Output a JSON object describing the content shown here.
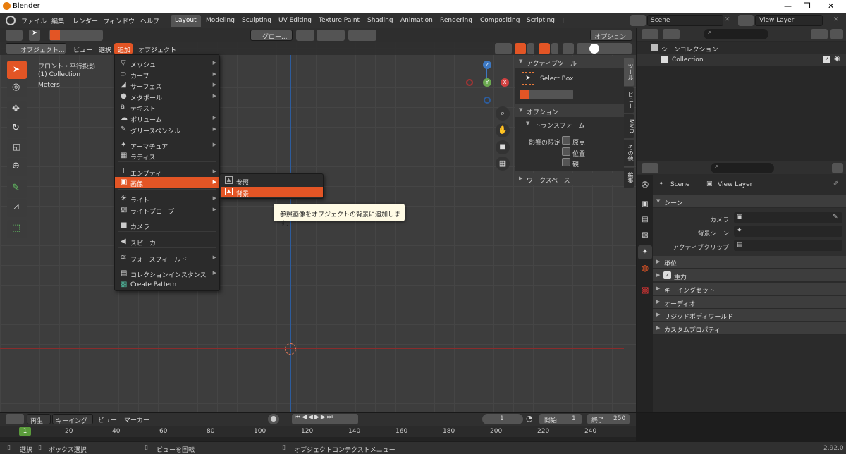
{
  "window": {
    "title": "Blender",
    "controls": [
      "—",
      "❐",
      "✕"
    ]
  },
  "menus": [
    "ファイル",
    "編集",
    "レンダー",
    "ウィンドウ",
    "ヘルプ"
  ],
  "workspaces": [
    "Layout",
    "Modeling",
    "Sculpting",
    "UV Editing",
    "Texture Paint",
    "Shading",
    "Animation",
    "Rendering",
    "Compositing",
    "Scripting"
  ],
  "add_tab": "+",
  "scene": {
    "name": "Scene",
    "view_layer": "View Layer"
  },
  "viewport": {
    "header": {
      "mode": "オブジェクト...",
      "view": "ビュー",
      "select": "選択",
      "add": "追加",
      "object": "オブジェクト",
      "transform": "グロー...",
      "options": "オプション"
    },
    "overlay": {
      "line1": "フロント・平行投影",
      "line2": "(1) Collection",
      "line3": "Meters"
    },
    "gizmo": {
      "z": "Z",
      "y": "Y",
      "x": "X"
    }
  },
  "add_menu": {
    "items": [
      {
        "icon": "▽",
        "label": "メッシュ",
        "sub": true
      },
      {
        "icon": "⊃",
        "label": "カーブ",
        "sub": true
      },
      {
        "icon": "◢",
        "label": "サーフェス",
        "sub": true
      },
      {
        "icon": "●",
        "label": "メタボール",
        "sub": true
      },
      {
        "icon": "a",
        "label": "テキスト",
        "sub": false
      },
      {
        "icon": "☁",
        "label": "ボリューム",
        "sub": true
      },
      {
        "icon": "✎",
        "label": "グリースペンシル",
        "sub": true
      },
      {
        "icon": "✦",
        "label": "アーマチュア",
        "sub": true
      },
      {
        "icon": "▦",
        "label": "ラティス",
        "sub": false
      },
      {
        "icon": "⊥",
        "label": "エンプティ",
        "sub": true
      },
      {
        "icon": "▣",
        "label": "画像",
        "sub": true
      },
      {
        "icon": "☀",
        "label": "ライト",
        "sub": true
      },
      {
        "icon": "▧",
        "label": "ライトプローブ",
        "sub": true
      },
      {
        "icon": "■",
        "label": "カメラ",
        "sub": false
      },
      {
        "icon": "◀",
        "label": "スピーカー",
        "sub": false
      },
      {
        "icon": "≋",
        "label": "フォースフィールド",
        "sub": true
      },
      {
        "icon": "▤",
        "label": "コレクションインスタンス",
        "sub": true
      },
      {
        "icon": "▩",
        "label": "Create Pattern",
        "sub": false
      }
    ],
    "image_sub": [
      {
        "label": "参照"
      },
      {
        "label": "背景"
      }
    ],
    "tooltip": "参照画像をオブジェクトの背景に追加します."
  },
  "npanel": {
    "active_tool": "アクティブツール",
    "select_box": "Select Box",
    "options": "オプション",
    "transform": "トランスフォーム",
    "affect_only": "影響の限定",
    "origins": "原点",
    "locations": "位置",
    "parents": "親",
    "workspace": "ワークスペース",
    "tabs": [
      "ツール",
      "ビュー",
      "MMD",
      "その他",
      "編集"
    ]
  },
  "outliner": {
    "scene_collection": "シーンコレクション",
    "collection": "Collection"
  },
  "properties": {
    "scene": "Scene",
    "view_layer": "View Layer",
    "section": "シーン",
    "camera": "カメラ",
    "bg_scene": "背景シーン",
    "active_clip": "アクティブクリップ",
    "rows": [
      {
        "label": "単位",
        "check": false
      },
      {
        "label": "重力",
        "check": true
      },
      {
        "label": "キーイングセット",
        "check": false
      },
      {
        "label": "オーディオ",
        "check": false
      },
      {
        "label": "リジッドボディワールド",
        "check": false
      },
      {
        "label": "カスタムプロパティ",
        "check": false
      }
    ]
  },
  "timeline": {
    "play": "再生",
    "keying": "キーイング",
    "view": "ビュー",
    "marker": "マーカー",
    "current": "1",
    "start_label": "開始",
    "start": "1",
    "end_label": "終了",
    "end": "250",
    "ticks": [
      "1",
      "20",
      "40",
      "60",
      "80",
      "100",
      "120",
      "140",
      "160",
      "180",
      "200",
      "220",
      "240"
    ]
  },
  "statusbar": {
    "select": "選択",
    "box_select": "ボックス選択",
    "rotate": "ビューを回転",
    "context": "オブジェクトコンテクストメニュー",
    "version": "2.92.0"
  }
}
